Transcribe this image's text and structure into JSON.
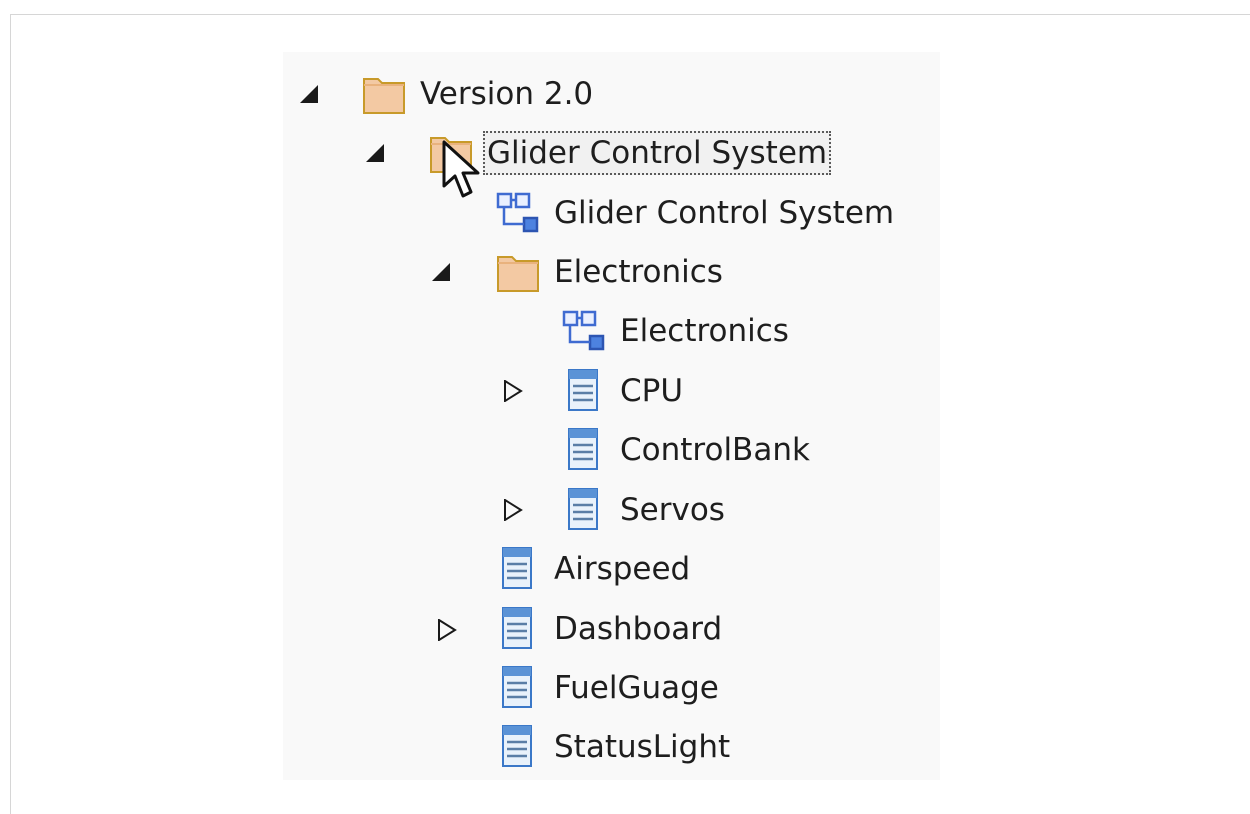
{
  "tree": {
    "root": {
      "label": "Version 2.0",
      "icon": "folder-icon",
      "expanded": true
    },
    "glider_package": {
      "label": "Glider Control System",
      "icon": "folder-icon",
      "expanded": true,
      "selected": true
    },
    "glider_diagram": {
      "label": "Glider Control System",
      "icon": "diagram-icon"
    },
    "electronics_package": {
      "label": "Electronics",
      "icon": "folder-icon",
      "expanded": true
    },
    "electronics_diagram": {
      "label": "Electronics",
      "icon": "diagram-icon"
    },
    "cpu": {
      "label": "CPU",
      "icon": "class-icon",
      "expanded": false
    },
    "controlbank": {
      "label": "ControlBank",
      "icon": "class-icon"
    },
    "servos": {
      "label": "Servos",
      "icon": "class-icon",
      "expanded": false
    },
    "airspeed": {
      "label": "Airspeed",
      "icon": "class-icon"
    },
    "dashboard": {
      "label": "Dashboard",
      "icon": "class-icon",
      "expanded": false
    },
    "fuelguage": {
      "label": "FuelGuage",
      "icon": "class-icon"
    },
    "statuslight": {
      "label": "StatusLight",
      "icon": "class-icon"
    }
  },
  "colors": {
    "folder_fill": "#f3c9a3",
    "folder_stroke": "#c89a2a",
    "diagram_blue": "#3f6bd1",
    "class_blue": "#3b78c8",
    "selection_outline": "#5a5a5a"
  }
}
